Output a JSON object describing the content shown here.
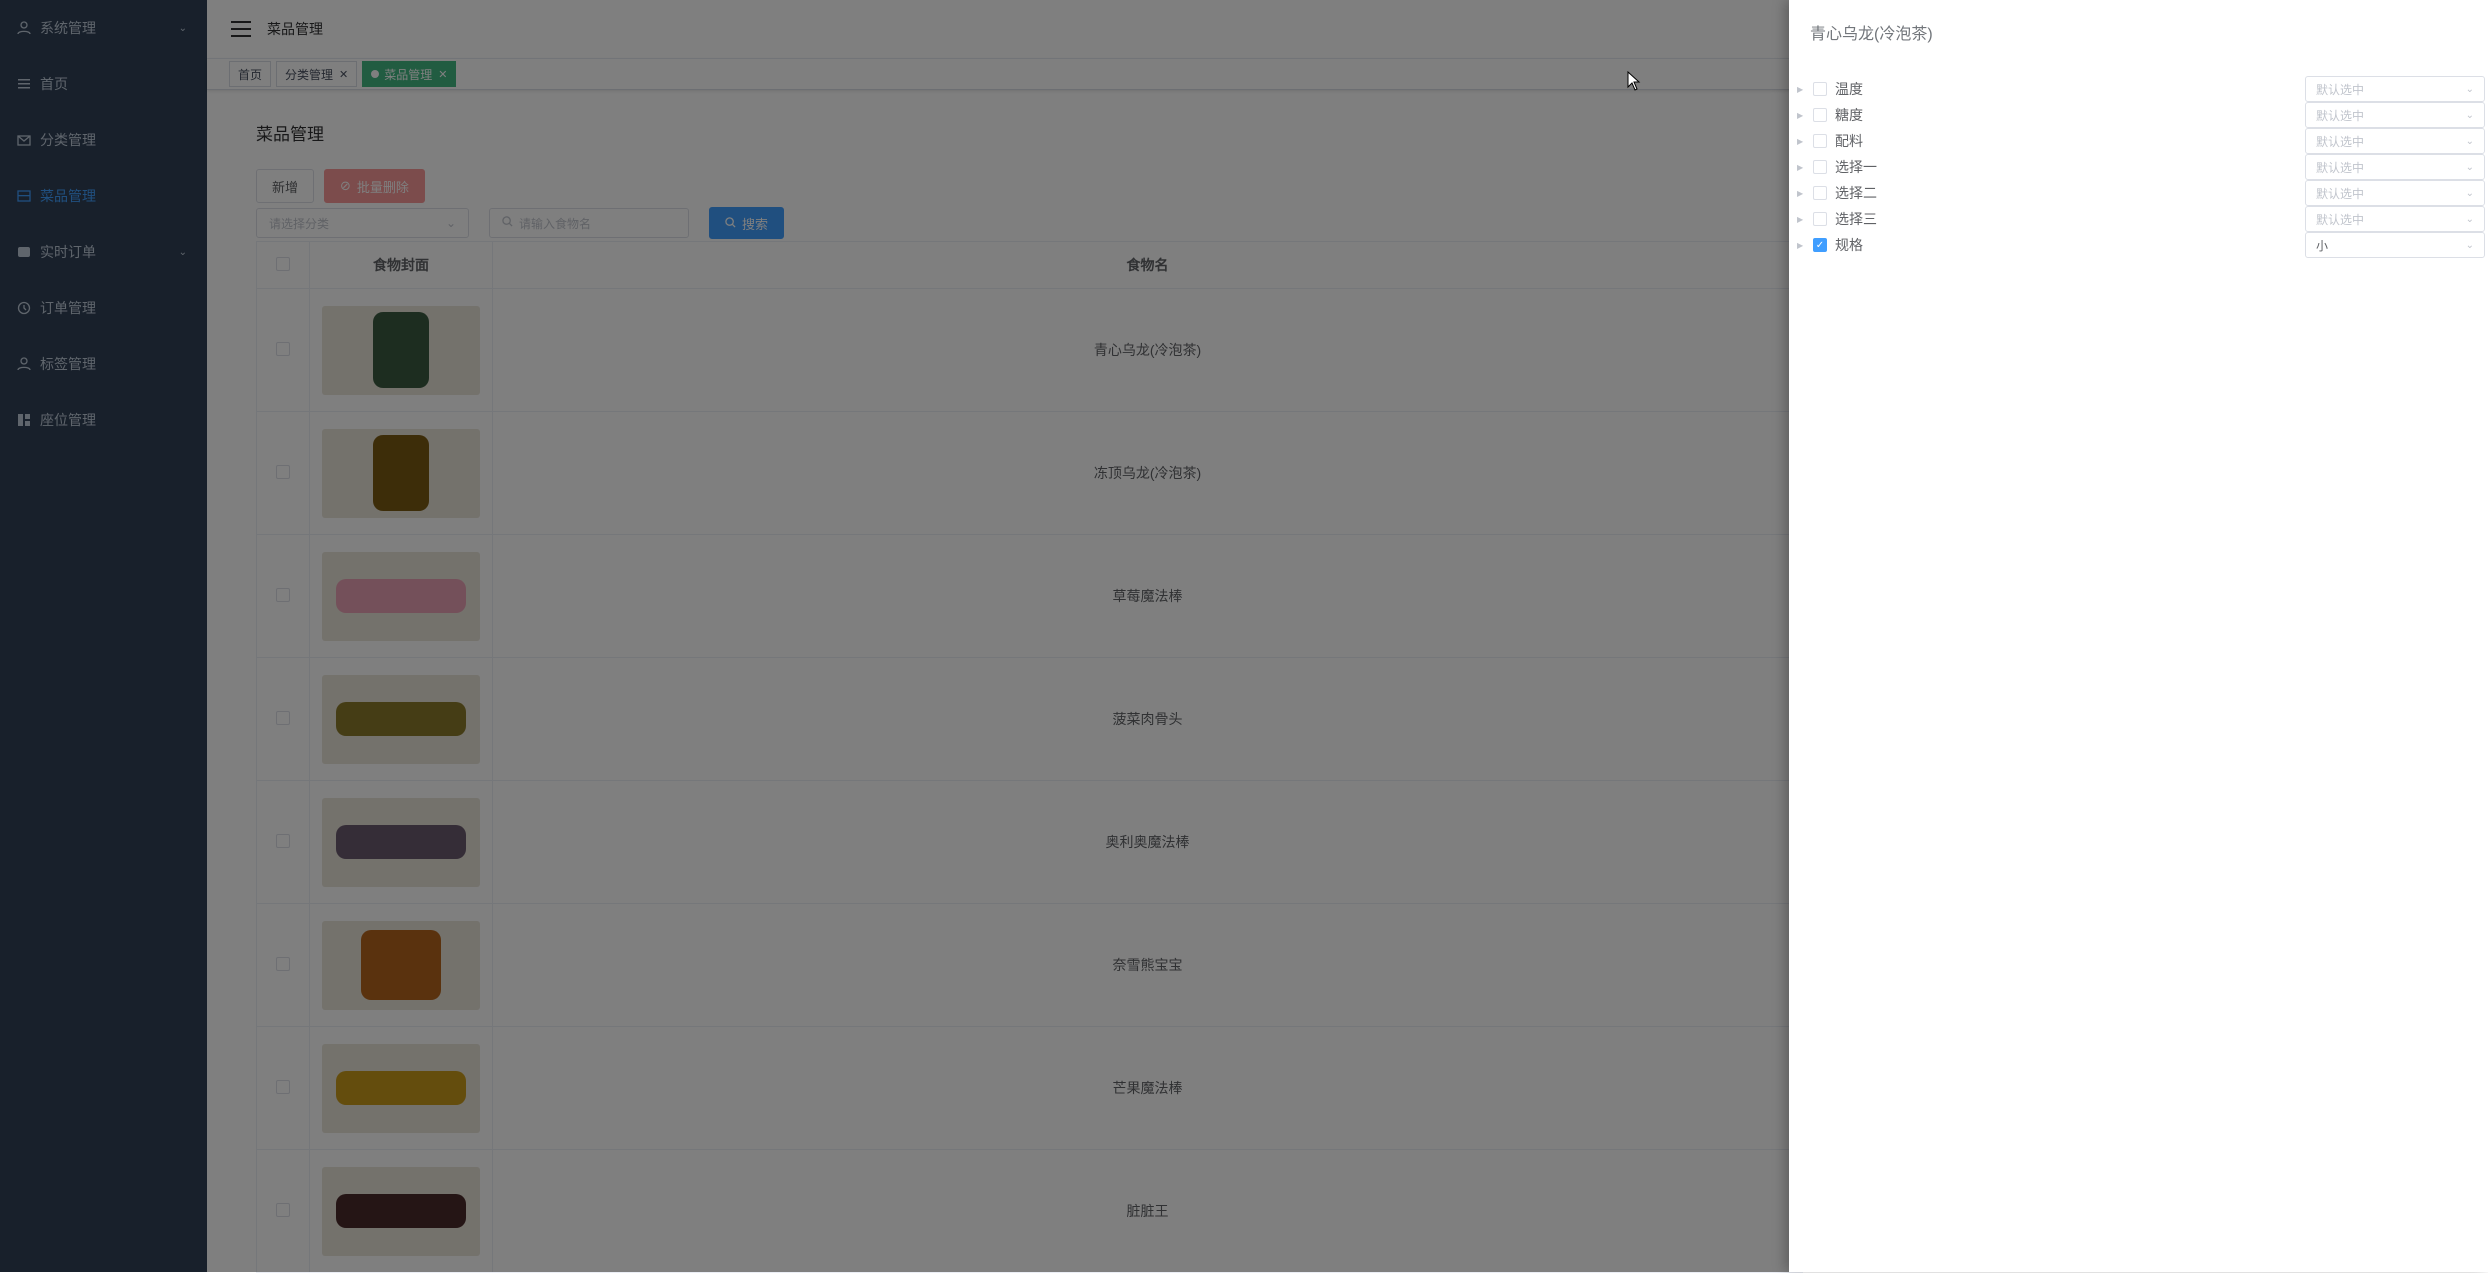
{
  "sidebar": {
    "items": [
      {
        "label": "系统管理",
        "icon": "user-icon",
        "has_arrow": true
      },
      {
        "label": "首页",
        "icon": "list-icon",
        "has_arrow": false
      },
      {
        "label": "分类管理",
        "icon": "mail-icon",
        "has_arrow": false
      },
      {
        "label": "菜品管理",
        "icon": "dish-icon",
        "has_arrow": false,
        "active": true
      },
      {
        "label": "实时订单",
        "icon": "realtime-icon",
        "has_arrow": true
      },
      {
        "label": "订单管理",
        "icon": "order-icon",
        "has_arrow": false
      },
      {
        "label": "标签管理",
        "icon": "tag-icon",
        "has_arrow": false
      },
      {
        "label": "座位管理",
        "icon": "seat-icon",
        "has_arrow": false
      }
    ],
    "colors": {
      "bg": "#304156",
      "text": "#bfcbd9",
      "active": "#409eff"
    }
  },
  "navbar": {
    "breadcrumb": "菜品管理"
  },
  "tags": [
    {
      "label": "首页",
      "closable": false,
      "active": false
    },
    {
      "label": "分类管理",
      "closable": true,
      "active": false
    },
    {
      "label": "菜品管理",
      "closable": true,
      "active": true
    }
  ],
  "main": {
    "title": "菜品管理",
    "buttons": {
      "add": "新增",
      "batch_delete": "批量删除",
      "search": "搜索"
    },
    "filters": {
      "category_placeholder": "请选择分类",
      "name_placeholder": "请输入食物名"
    },
    "table": {
      "headers": {
        "cover": "食物封面",
        "name": "食物名"
      },
      "rows": [
        {
          "name": "青心乌龙(冷泡茶)",
          "cover_color": "#3a5a40"
        },
        {
          "name": "冻顶乌龙(冷泡茶)",
          "cover_color": "#7a5a12"
        },
        {
          "name": "草莓魔法棒",
          "cover_color": "#e8a0b4"
        },
        {
          "name": "菠菜肉骨头",
          "cover_color": "#8a7a2a"
        },
        {
          "name": "奥利奥魔法棒",
          "cover_color": "#6a5a6e"
        },
        {
          "name": "奈雪熊宝宝",
          "cover_color": "#b5651d"
        },
        {
          "name": "芒果魔法棒",
          "cover_color": "#c89a1a"
        },
        {
          "name": "脏脏王",
          "cover_color": "#4a2a2a"
        }
      ]
    }
  },
  "drawer": {
    "title": "青心乌龙(冷泡茶)",
    "options": [
      {
        "label": "温度",
        "checked": false,
        "value": "默认选中"
      },
      {
        "label": "糖度",
        "checked": false,
        "value": "默认选中"
      },
      {
        "label": "配料",
        "checked": false,
        "value": "默认选中"
      },
      {
        "label": "选择一",
        "checked": false,
        "value": "默认选中"
      },
      {
        "label": "选择二",
        "checked": false,
        "value": "默认选中"
      },
      {
        "label": "选择三",
        "checked": false,
        "value": "默认选中"
      },
      {
        "label": "规格",
        "checked": true,
        "value": "小"
      }
    ]
  }
}
